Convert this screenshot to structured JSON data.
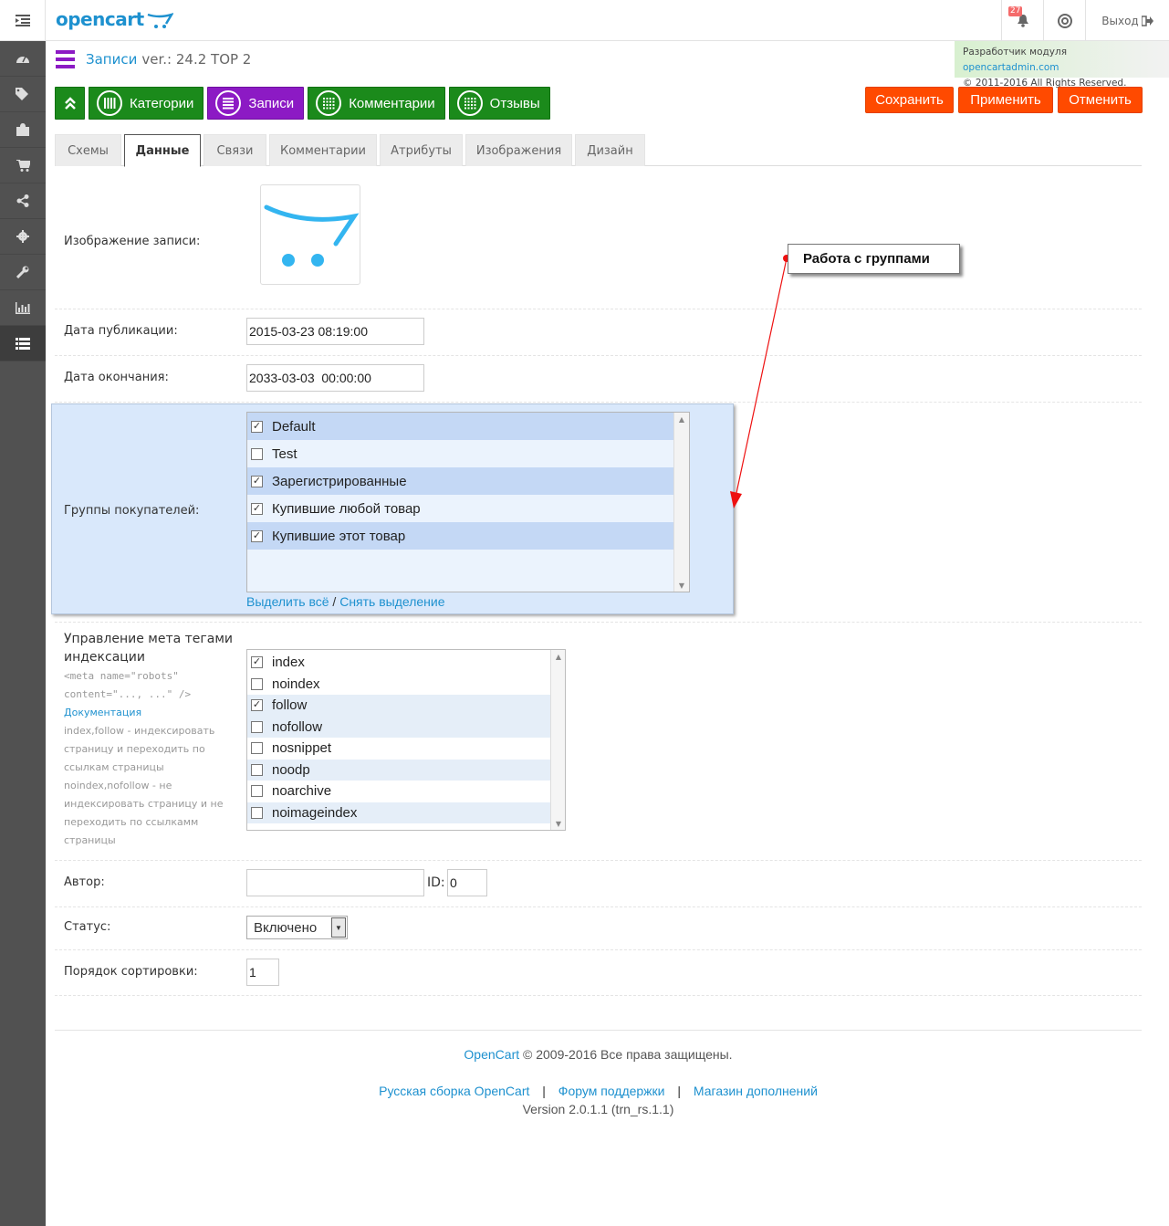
{
  "header": {
    "logo": "opencart",
    "notifications_count": "27",
    "logout_label": "Выход"
  },
  "dev_note": {
    "prefix": "Разработчик модуля",
    "link": "opencartadmin.com",
    "copyright": "© 2011-2016 All Rights Reserved."
  },
  "page": {
    "title_link": "Записи",
    "version": "ver.: 24.2 TOP 2"
  },
  "nav_buttons": [
    "Категории",
    "Записи",
    "Комментарии",
    "Отзывы"
  ],
  "actions": {
    "save": "Сохранить",
    "apply": "Применить",
    "cancel": "Отменить"
  },
  "tabs": [
    "Схемы",
    "Данные",
    "Связи",
    "Комментарии",
    "Атрибуты",
    "Изображения",
    "Дизайн"
  ],
  "form": {
    "image_label": "Изображение записи:",
    "pub_date_label": "Дата публикации:",
    "pub_date_value": "2015-03-23 08:19:00",
    "end_date_label": "Дата окончания:",
    "end_date_value": "2033-03-03  00:00:00",
    "groups_label": "Группы покупателей:",
    "groups": [
      {
        "name": "Default",
        "checked": true
      },
      {
        "name": "Test",
        "checked": false
      },
      {
        "name": "Зарегистрированные",
        "checked": true
      },
      {
        "name": "Купившие любой товар",
        "checked": true
      },
      {
        "name": "Купившие этот товар",
        "checked": true
      }
    ],
    "select_all": "Выделить всё",
    "select_sep": " / ",
    "deselect": "Снять выделение",
    "meta_label": "Управление мета тегами индексации",
    "meta_code": "<meta name=\"robots\" content=\"..., ...\" />",
    "meta_doc": "Документация",
    "meta_help": "index,follow - индексировать страницу и переходить по ссылкам страницы noindex,nofollow - не индексировать страницу и не переходить по ссылкамм страницы",
    "meta_tags": [
      {
        "name": "index",
        "checked": true
      },
      {
        "name": "noindex",
        "checked": false
      },
      {
        "name": "follow",
        "checked": true
      },
      {
        "name": "nofollow",
        "checked": false
      },
      {
        "name": "nosnippet",
        "checked": false
      },
      {
        "name": "noodp",
        "checked": false
      },
      {
        "name": "noarchive",
        "checked": false
      },
      {
        "name": "noimageindex",
        "checked": false
      }
    ],
    "author_label": "Автор:",
    "author_value": "",
    "id_label": "ID:",
    "id_value": "0",
    "status_label": "Статус:",
    "status_value": "Включено",
    "sort_label": "Порядок сортировки:",
    "sort_value": "1"
  },
  "callout": "Работа с группами",
  "footer": {
    "brand": "OpenCart",
    "copyright": " © 2009-2016 Все права защищены.",
    "links": [
      "Русская сборка OpenCart",
      "Форум поддержки",
      "Магазин дополнений"
    ],
    "version": "Version 2.0.1.1 (trn_rs.1.1)"
  },
  "colors": {
    "accent": "#1e91cf",
    "green": "#1b8a1b",
    "purple": "#8c1ac4",
    "orange": "#ff4a00",
    "sidebar": "#515151"
  }
}
